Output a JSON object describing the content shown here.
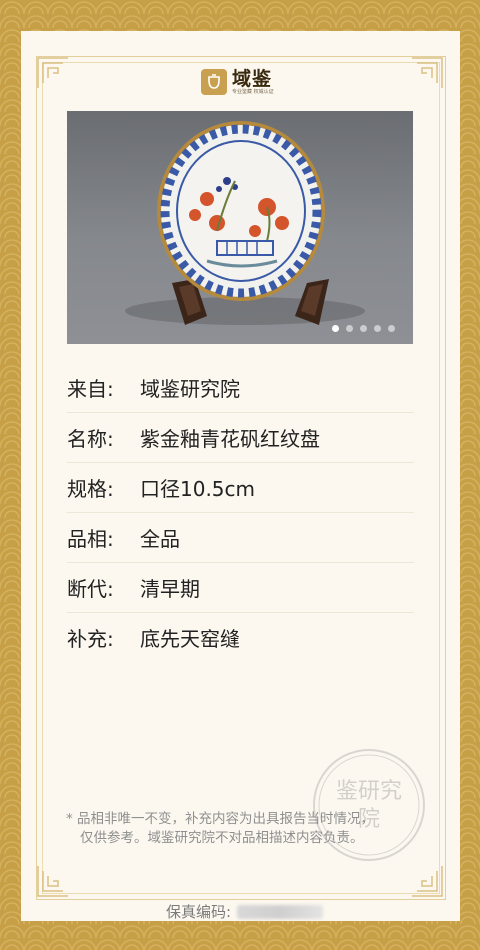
{
  "brand": {
    "name": "域鉴",
    "tagline": "专业鉴藏 权威认证"
  },
  "gallery": {
    "slide_count": 5,
    "active_index": 0
  },
  "details": [
    {
      "label": "来自:",
      "value": "域鉴研究院"
    },
    {
      "label": "名称:",
      "value": "紫金釉青花矾红纹盘"
    },
    {
      "label": "规格:",
      "value": "口径10.5cm"
    },
    {
      "label": "品相:",
      "value": "全品"
    },
    {
      "label": "断代:",
      "value": "清早期"
    },
    {
      "label": "补充:",
      "value": "底先天窑缝"
    }
  ],
  "note": {
    "line1": "* 品相非唯一不变，补充内容为出具报告当时情况，",
    "line2": "仅供参考。域鉴研究院不对品相描述内容负责。"
  },
  "serial": {
    "label": "保真编码:"
  },
  "stamp": {
    "text": "域鉴研究院"
  },
  "colors": {
    "gold": "#c79f47",
    "card": "#fcf8f0",
    "frame": "#e2cf9c"
  }
}
